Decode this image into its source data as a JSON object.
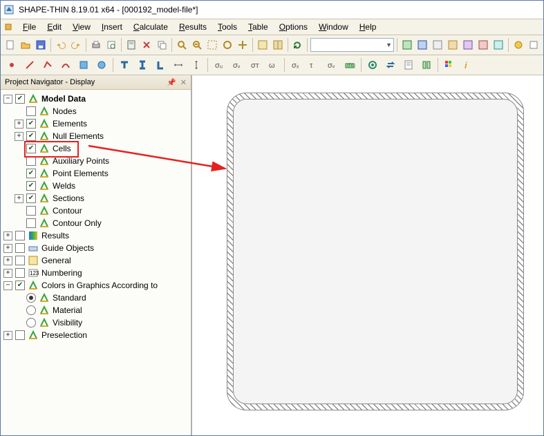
{
  "title": "SHAPE-THIN 8.19.01 x64 - [000192_model-file*]",
  "menu": [
    "File",
    "Edit",
    "View",
    "Insert",
    "Calculate",
    "Results",
    "Tools",
    "Table",
    "Options",
    "Window",
    "Help"
  ],
  "navigator": {
    "title": "Project Navigator - Display"
  },
  "tree": {
    "model_data": "Model Data",
    "nodes": "Nodes",
    "elements": "Elements",
    "null_elements": "Null Elements",
    "cells": "Cells",
    "aux_points": "Auxiliary Points",
    "point_elements": "Point Elements",
    "welds": "Welds",
    "sections": "Sections",
    "contour": "Contour",
    "contour_only": "Contour Only",
    "results": "Results",
    "guide_objects": "Guide Objects",
    "general": "General",
    "numbering": "Numbering",
    "colors": "Colors in Graphics According to",
    "standard": "Standard",
    "material": "Material",
    "visibility": "Visibility",
    "preselection": "Preselection"
  },
  "checks": {
    "model_data": true,
    "nodes": false,
    "elements": true,
    "null_elements": true,
    "cells": true,
    "aux_points": false,
    "point_elements": true,
    "welds": true,
    "sections": true,
    "contour": false,
    "contour_only": false,
    "results": false,
    "guide_objects": false,
    "general": false,
    "numbering": false,
    "colors": true,
    "preselection": false
  },
  "radio": {
    "standard": true,
    "material": false,
    "visibility": false
  },
  "highlight": "cells",
  "colors_hex": {
    "highlight": "#e62020",
    "arrow": "#e62020"
  }
}
